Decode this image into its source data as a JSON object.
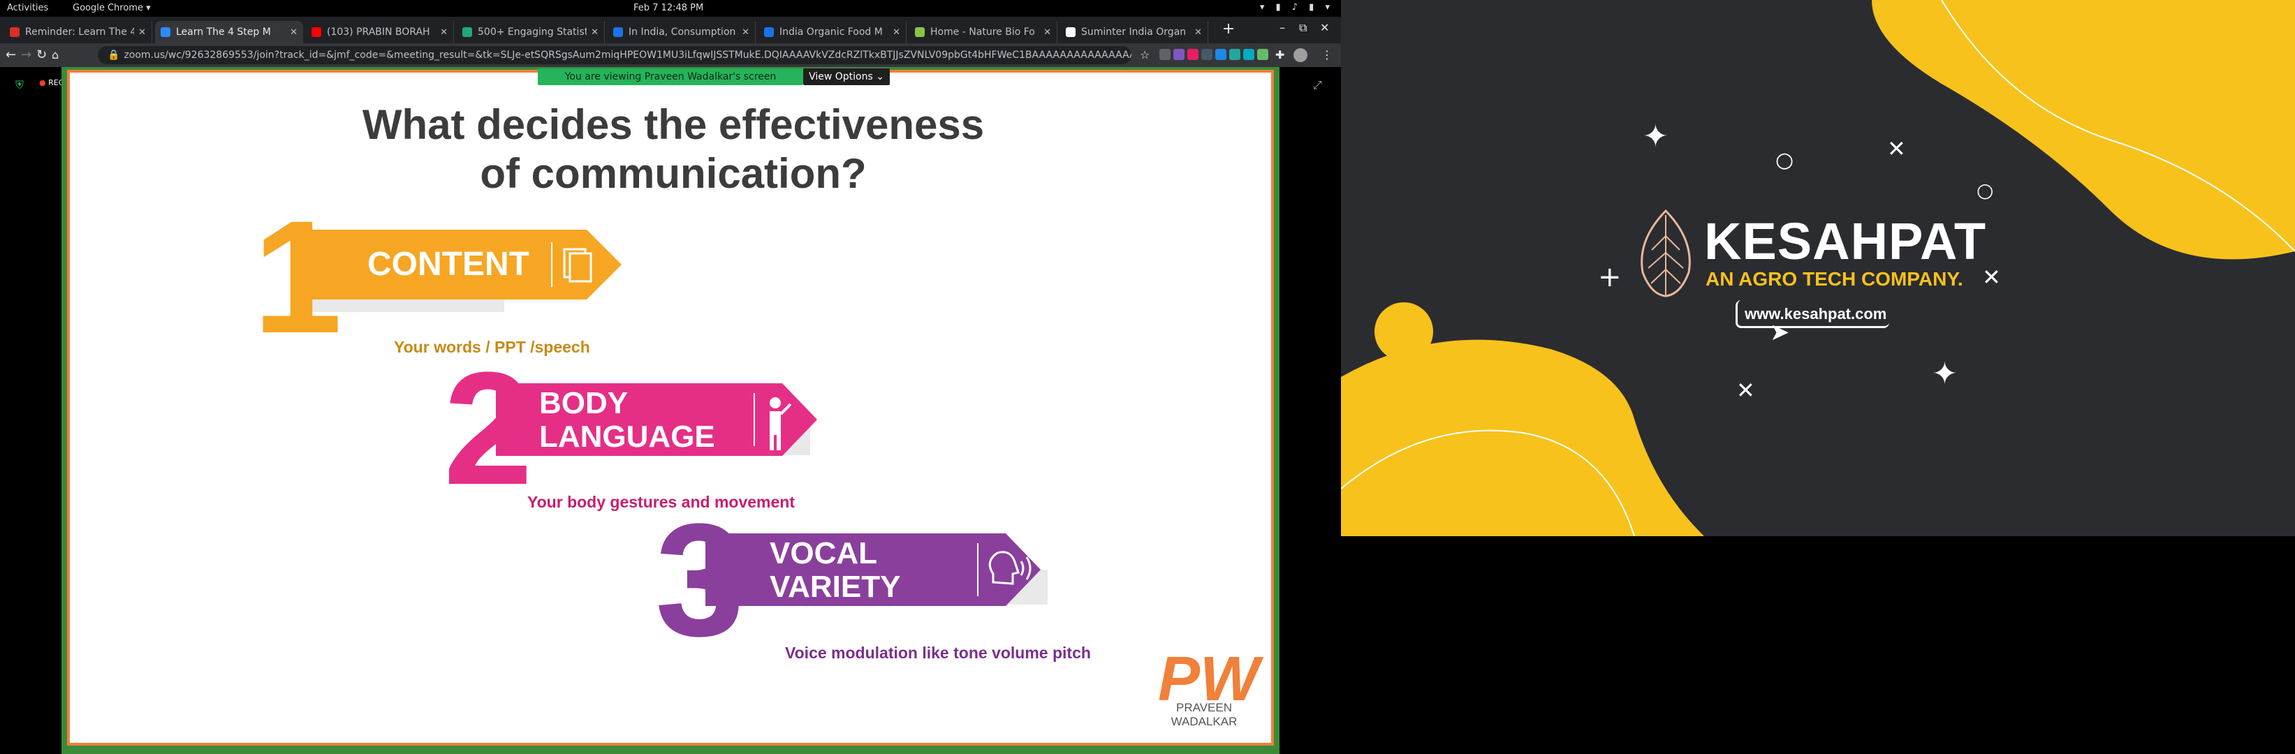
{
  "topbar": {
    "activities": "Activities",
    "app": "Google Chrome ▾",
    "clock": "Feb 7  12:48 PM",
    "tray": "▾ ▮ ♪ ▮ ▾"
  },
  "tabs": [
    {
      "title": "Reminder: Learn The 4",
      "favicon": "gmail-icon",
      "color": "#d93025",
      "active": false
    },
    {
      "title": "Learn The 4 Step M",
      "favicon": "zoom-icon",
      "color": "#2d8cff",
      "active": true
    },
    {
      "title": "(103) PRABIN BORAH",
      "favicon": "youtube-icon",
      "color": "#ff0000",
      "active": false
    },
    {
      "title": "500+ Engaging Statist",
      "favicon": "site-icon",
      "color": "#27a57a",
      "active": false
    },
    {
      "title": "In India, Consumption",
      "favicon": "site-icon",
      "color": "#1a73e8",
      "active": false
    },
    {
      "title": "India Organic Food M",
      "favicon": "chart-icon",
      "color": "#1a73e8",
      "active": false
    },
    {
      "title": "Home - Nature Bio Fo",
      "favicon": "leaf-icon",
      "color": "#8bc34a",
      "active": false
    },
    {
      "title": "Suminter India Organ",
      "favicon": "google-icon",
      "color": "#ffffff",
      "active": false
    }
  ],
  "browser": {
    "url": "zoom.us/wc/92632869553/join?track_id=&jmf_code=&meeting_result=&tk=SLJe-etSQRSgsAum2miqHPEOW1MU3iLfqwIJSSTMukE.DQIAAAAVkVZdcRZlTkxBTJJsZVNLV09pbGt4bHFWeC1BAAAAAAAAAAAAAAAAAAAAAAA..."
  },
  "zoom": {
    "rec": "REC",
    "share_banner": "You are viewing Praveen Wadalkar's screen",
    "view_options": "View Options ⌄"
  },
  "slide": {
    "title_line1": "What decides the effectiveness",
    "title_line2": "of communication?",
    "items": [
      {
        "number": "1",
        "label": "CONTENT",
        "label2": "",
        "sub": "Your words / PPT /speech",
        "color": "#f6a623",
        "sub_color": "#c88a17",
        "icon": "document-icon"
      },
      {
        "number": "2",
        "label": "BODY",
        "label2": "LANGUAGE",
        "sub": "Your body gestures and movement",
        "color": "#e52f86",
        "sub_color": "#c71e6e",
        "icon": "gesture-icon"
      },
      {
        "number": "3",
        "label": "VOCAL",
        "label2": "VARIETY",
        "sub": "Voice modulation like tone volume pitch",
        "color": "#8a3f9c",
        "sub_color": "#7a2f8c",
        "icon": "voice-icon"
      }
    ],
    "logo": "PW",
    "author": "PRAVEEN WADALKAR"
  },
  "kesahpat": {
    "name": "KESAHPAT",
    "tagline": "AN AGRO TECH COMPANY.",
    "url": "www.kesahpat.com",
    "accent": "#f7c21b"
  }
}
